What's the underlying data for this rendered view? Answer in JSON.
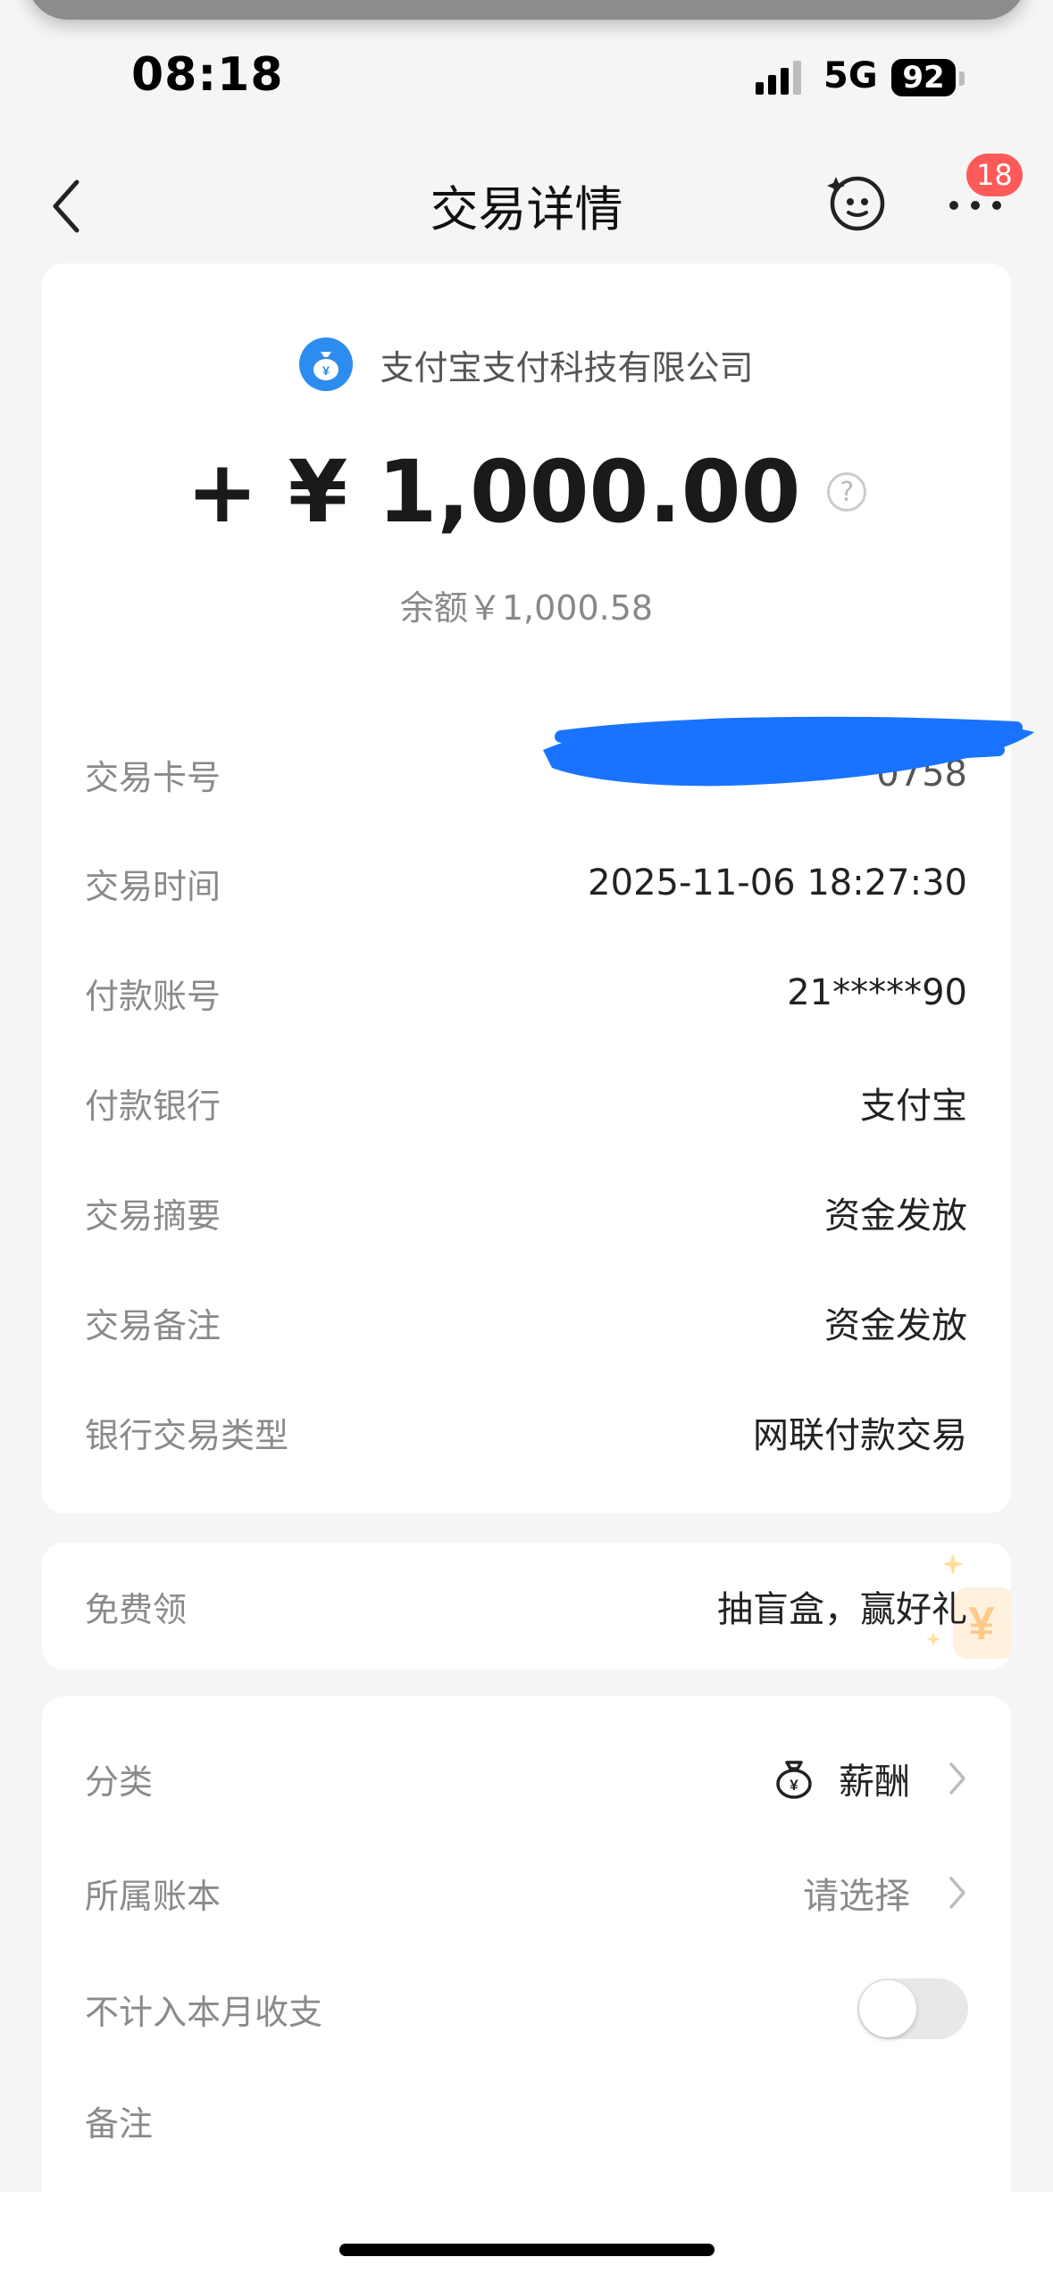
{
  "status_bar": {
    "time": "08:18",
    "network": "5G",
    "battery": "92"
  },
  "nav": {
    "title": "交易详情",
    "badge_count": "18",
    "back_icon": "chevron-left-icon",
    "assistant_icon": "smiley-assistant-icon",
    "more_icon": "more-dots-icon"
  },
  "summary": {
    "merchant_name": "支付宝支付科技有限公司",
    "amount": "+ ¥ 1,000.00",
    "balance": "余额￥1,000.58"
  },
  "details": [
    {
      "label": "交易卡号",
      "value": "0758"
    },
    {
      "label": "交易时间",
      "value": "2025-11-06 18:27:30"
    },
    {
      "label": "付款账号",
      "value": "21*****90"
    },
    {
      "label": "付款银行",
      "value": "支付宝"
    },
    {
      "label": "交易摘要",
      "value": "资金发放"
    },
    {
      "label": "交易备注",
      "value": "资金发放"
    },
    {
      "label": "银行交易类型",
      "value": "网联付款交易"
    }
  ],
  "promo": {
    "label": "免费领",
    "value": "抽盲盒，赢好礼"
  },
  "settings": {
    "category_label": "分类",
    "category_value": "薪酬",
    "ledger_label": "所属账本",
    "ledger_value": "请选择",
    "exclude_label": "不计入本月收支",
    "exclude_on": false,
    "note_label": "备注"
  },
  "colors": {
    "accent_blue": "#2d8cf0",
    "badge_red": "#ff5a5a",
    "redaction_blue": "#1a73ff"
  }
}
